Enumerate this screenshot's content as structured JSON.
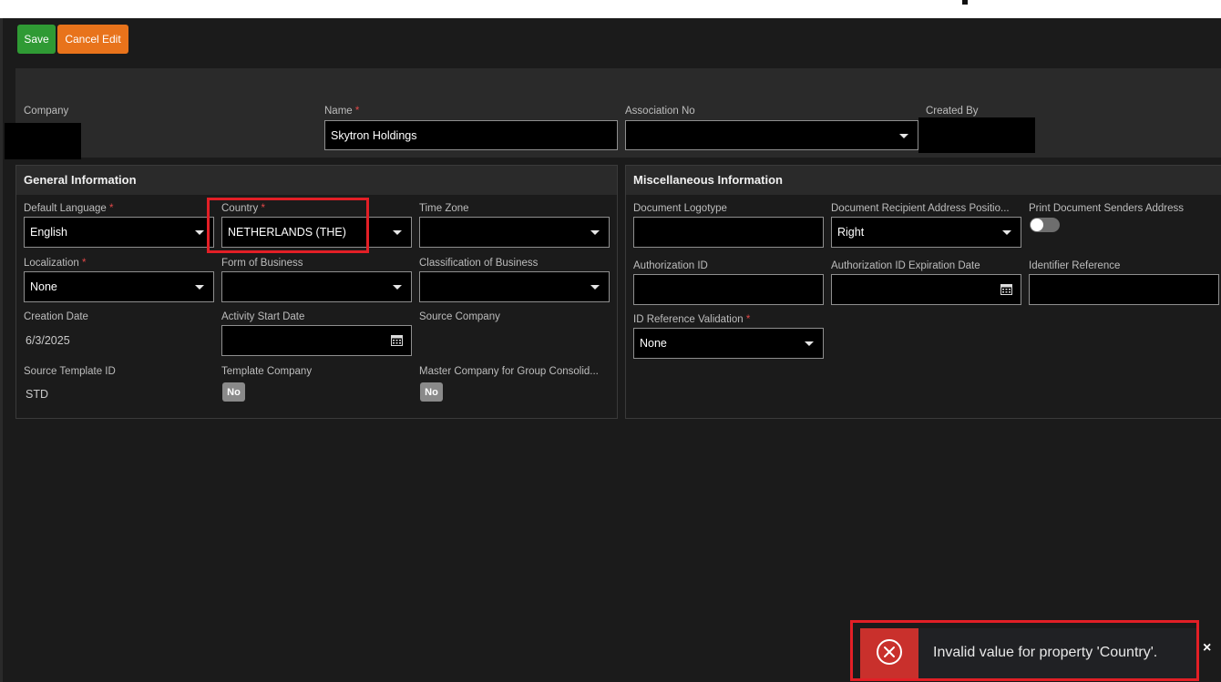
{
  "toolbar": {
    "save_label": "Save",
    "cancel_label": "Cancel Edit"
  },
  "header": {
    "company_label": "Company",
    "name_label": "Name",
    "name_value": "Skytron Holdings",
    "association_label": "Association No",
    "association_value": "",
    "created_by_label": "Created By"
  },
  "required_marker": "*",
  "general": {
    "title": "General Information",
    "default_language_label": "Default Language",
    "default_language_value": "English",
    "country_label": "Country",
    "country_value": "NETHERLANDS (THE)",
    "time_zone_label": "Time Zone",
    "time_zone_value": "",
    "localization_label": "Localization",
    "localization_value": "None",
    "form_of_business_label": "Form of Business",
    "form_of_business_value": "",
    "classification_label": "Classification of Business",
    "classification_value": "",
    "creation_date_label": "Creation Date",
    "creation_date_value": "6/3/2025",
    "activity_start_label": "Activity Start Date",
    "activity_start_value": "",
    "source_company_label": "Source Company",
    "source_template_label": "Source Template ID",
    "source_template_value": "STD",
    "template_company_label": "Template Company",
    "template_company_value": "No",
    "master_company_label": "Master Company for Group Consolid...",
    "master_company_value": "No"
  },
  "misc": {
    "title": "Miscellaneous Information",
    "logotype_label": "Document Logotype",
    "logotype_value": "",
    "recipient_position_label": "Document Recipient Address Positio...",
    "recipient_position_value": "Right",
    "print_senders_label": "Print Document Senders Address",
    "print_senders_on": false,
    "auth_id_label": "Authorization ID",
    "auth_id_value": "",
    "auth_exp_label": "Authorization ID Expiration Date",
    "auth_exp_value": "",
    "identifier_ref_label": "Identifier Reference",
    "identifier_ref_value": "",
    "id_ref_validation_label": "ID Reference Validation",
    "id_ref_validation_value": "None"
  },
  "toast": {
    "message": "Invalid value for property 'Country'.",
    "icon": "error-circle-x-icon",
    "close_glyph": "×",
    "color": "#c9302c"
  }
}
